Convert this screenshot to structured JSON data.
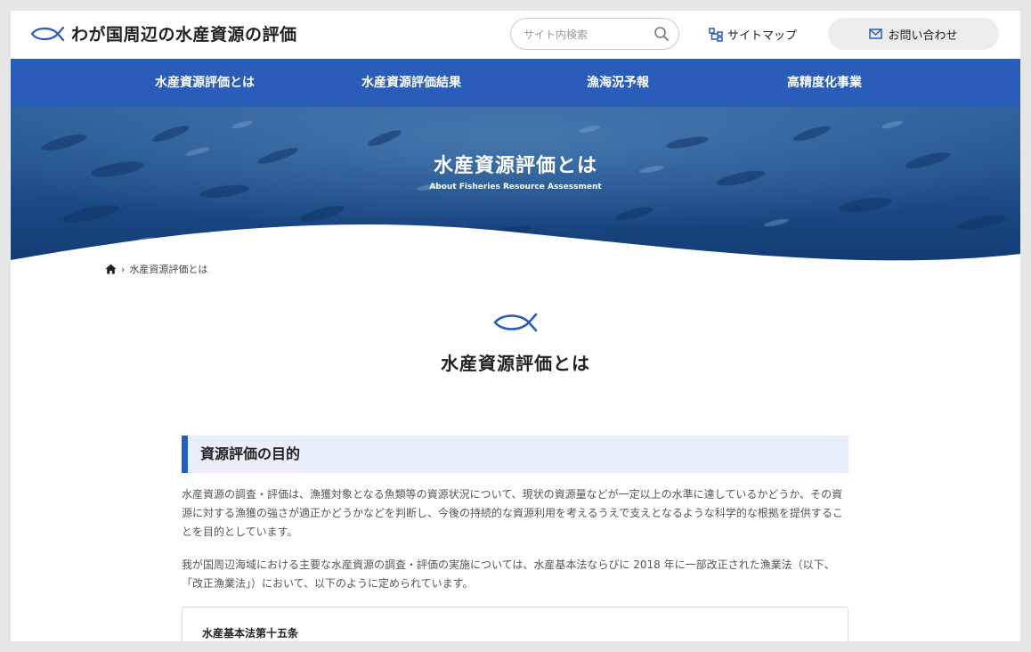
{
  "header": {
    "site_title": "わが国周辺の水産資源の評価",
    "search_placeholder": "サイト内検索",
    "sitemap_label": "サイトマップ",
    "contact_label": "お問い合わせ"
  },
  "nav": {
    "items": [
      {
        "label": "水産資源評価とは"
      },
      {
        "label": "水産資源評価結果"
      },
      {
        "label": "漁海況予報"
      },
      {
        "label": "高精度化事業"
      }
    ]
  },
  "hero": {
    "title": "水産資源評価とは",
    "subtitle": "About Fisheries Resource Assessment"
  },
  "breadcrumb": {
    "current": "水産資源評価とは"
  },
  "main": {
    "page_title": "水産資源評価とは",
    "section_heading": "資源評価の目的",
    "paragraph1": "水産資源の調査・評価は、漁獲対象となる魚類等の資源状況について、現状の資源量などが一定以上の水準に達しているかどうか、その資源に対する漁獲の強さが適正かどうかなどを判断し、今後の持続的な資源利用を考えるうえで支えとなるような科学的な根拠を提供することを目的としています。",
    "paragraph2": "我が国周辺海域における主要な水産資源の調査・評価の実施については、水産基本法ならびに 2018 年に一部改正された漁業法（以下、「改正漁業法」）において、以下のように定められています。",
    "law_title": "水産基本法第十五条"
  },
  "colors": {
    "brand_blue": "#2a5cb9",
    "heading_bg": "#e8eefa"
  }
}
